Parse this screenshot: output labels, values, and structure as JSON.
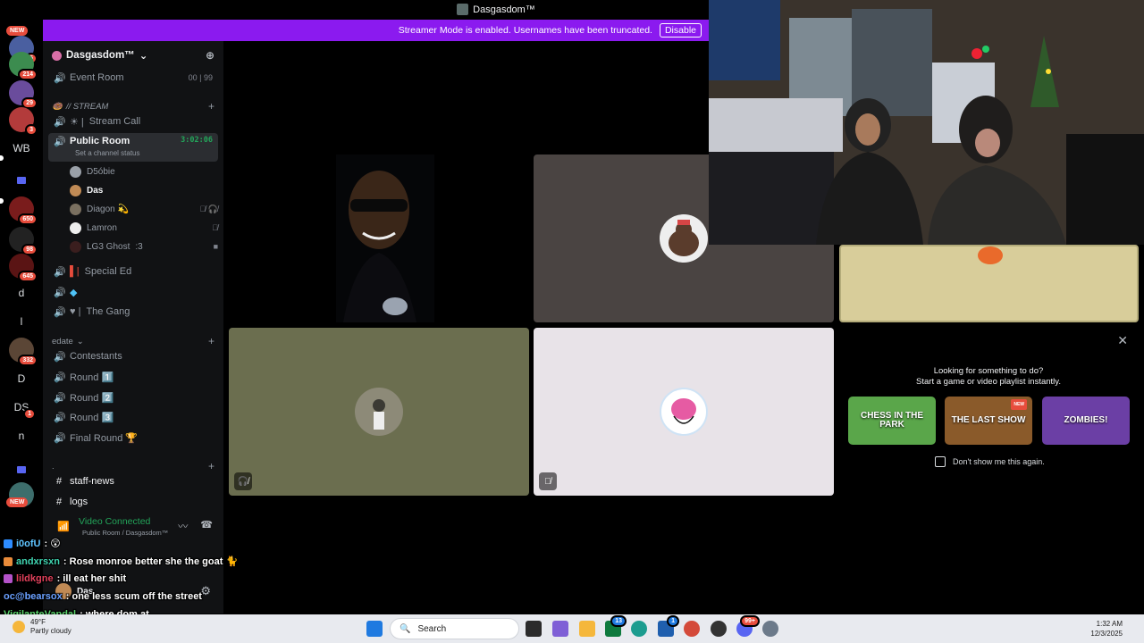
{
  "window": {
    "title": "Dasgasdom™"
  },
  "banner": {
    "text": "Streamer Mode is enabled. Usernames have been truncated.",
    "disable_label": "Disable"
  },
  "rail": {
    "items": [
      {
        "label": "NEW",
        "kind": "badge"
      },
      {
        "count": "5"
      },
      {
        "count": "214"
      },
      {
        "count": "29"
      },
      {
        "count": "3"
      },
      {
        "label": "WB"
      },
      {
        "count": "650"
      },
      {
        "count": "98"
      },
      {
        "count": "645"
      },
      {
        "label": "d"
      },
      {
        "label": "l"
      },
      {
        "count": "332"
      },
      {
        "label": "D"
      },
      {
        "label": "DS",
        "count": "1"
      },
      {
        "label": "n"
      },
      {
        "label": "NEW",
        "kind": "badge"
      }
    ]
  },
  "sidebar": {
    "guild_name": "Dasgasdom™",
    "event_room": {
      "label": "Event Room",
      "c1": "00",
      "c2": "99"
    },
    "cat_stream": "// STREAM",
    "stream_call": "Stream Call",
    "public_room": {
      "label": "Public Room",
      "timer": "3:02:06",
      "status": "Set a channel status"
    },
    "members": [
      {
        "name": "D5óbie"
      },
      {
        "name": "Das"
      },
      {
        "name": "Diagon 💫"
      },
      {
        "name": "Lamron"
      },
      {
        "name": "LG3 Ghost",
        "extra": ":3"
      }
    ],
    "special_ed": "Special Ed",
    "the_gang": "The Gang",
    "cat_edate": "edate",
    "contestants": "Contestants",
    "round1": "Round 1️⃣",
    "round2": "Round 2️⃣",
    "round3": "Round 3️⃣",
    "final_round": "Final Round 🏆",
    "cat_dot": ".",
    "staff_news": "staff-news",
    "logs": "logs",
    "voice": {
      "title": "Video Connected",
      "sub": "Public Room / Dasgasdom™"
    },
    "user": {
      "name": "Das"
    }
  },
  "activity": {
    "line1": "Looking for something to do?",
    "line2": "Start a game or video playlist instantly.",
    "cards": [
      {
        "label": "CHESS IN THE PARK"
      },
      {
        "label": "THE LAST SHOW",
        "tag": "NEW"
      },
      {
        "label": "ZOMBIES!"
      }
    ],
    "dont_show": "Don't show me this again."
  },
  "chat": [
    {
      "user": "i0ofU",
      "msg": ": 😲"
    },
    {
      "user": "andxrsxn",
      "msg": ": Rose monroe better she the goat 🐈"
    },
    {
      "user": "lildkgne",
      "msg": ": ill eat her shit"
    },
    {
      "user": "oc@bearsox",
      "msg": ": one less scum off the street"
    },
    {
      "user": "VigilanteVandal",
      "msg": ": where dom at"
    }
  ],
  "taskbar": {
    "weather_temp": "49°F",
    "weather_desc": "Partly cloudy",
    "search_placeholder": "Search",
    "time": "1:32 AM",
    "date": "12/3/2025",
    "badge_13": "13",
    "badge_1": "1",
    "badge_99": "99+"
  },
  "colors": {
    "banner": "#8b1aef",
    "sidebar": "#111214",
    "connected": "#23a55a"
  }
}
